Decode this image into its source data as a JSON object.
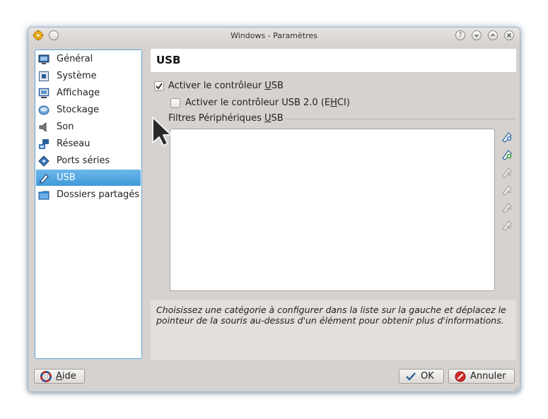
{
  "window": {
    "title": "Windows - Paramètres",
    "controls": [
      "help",
      "minimize",
      "maximize",
      "close"
    ]
  },
  "sidebar": {
    "items": [
      {
        "label": "Général",
        "icon": "monitor-general-icon"
      },
      {
        "label": "Système",
        "icon": "chip-system-icon"
      },
      {
        "label": "Affichage",
        "icon": "monitor-display-icon"
      },
      {
        "label": "Stockage",
        "icon": "disk-storage-icon"
      },
      {
        "label": "Son",
        "icon": "speaker-icon"
      },
      {
        "label": "Réseau",
        "icon": "network-icon"
      },
      {
        "label": "Ports séries",
        "icon": "serial-port-icon"
      },
      {
        "label": "USB",
        "icon": "usb-icon",
        "selected": true
      },
      {
        "label": "Dossiers partagés",
        "icon": "folder-icon"
      }
    ]
  },
  "page": {
    "title": "USB",
    "enable_usb": {
      "label_pre": "Activer le contrôleur ",
      "label_u": "U",
      "label_post": "SB",
      "checked": true
    },
    "enable_usb2": {
      "label_pre": "Activer le contrôleur USB 2.0 (E",
      "label_u": "H",
      "label_post": "CI)",
      "checked": false
    },
    "filters_group": {
      "label_pre": "Filtres Périphériques ",
      "label_u": "U",
      "label_post": "SB"
    },
    "filter_tools": [
      "add-filter-icon",
      "add-from-device-icon",
      "edit-filter-icon",
      "remove-filter-icon",
      "move-up-icon",
      "move-down-icon"
    ],
    "info": "Choisissez une catégorie à configurer dans la liste sur la gauche et déplacez le pointeur de la souris au-dessus d'un élément pour obtenir plus d'informations."
  },
  "buttons": {
    "help": {
      "u": "A",
      "rest": "ide"
    },
    "ok": "OK",
    "cancel": "Annuler"
  },
  "colors": {
    "selection": "#3f9ad8",
    "window_bg": "#d6d2d0",
    "focus_border": "#5fa8d8"
  }
}
